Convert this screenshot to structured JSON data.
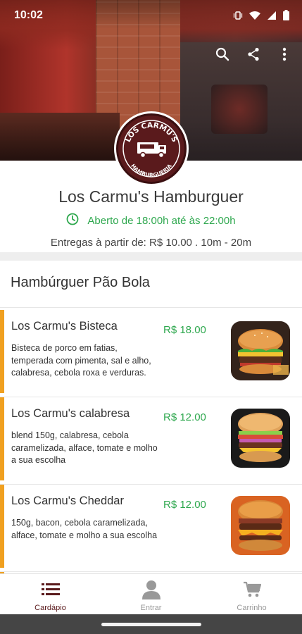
{
  "status_bar": {
    "time": "10:02"
  },
  "store": {
    "name": "Los Carmu's Hamburguer",
    "hours": "Aberto de 18:00h até às 22:00h",
    "delivery": "Entregas à partir de: R$ 10.00 . 10m - 20m",
    "logo_text_top": "LOS CARMU'S",
    "logo_text_bottom": "HAMBURGUERIA"
  },
  "section": {
    "title": "Hambúrguer Pão Bola"
  },
  "products": [
    {
      "name": "Los Carmu's Bisteca",
      "price": "R$ 18.00",
      "description": "Bisteca de porco em fatias, temperada com pimenta, sal e alho, calabresa, cebola roxa e verduras."
    },
    {
      "name": "Los Carmu's calabresa",
      "price": "R$ 12.00",
      "description": "blend 150g, calabresa, cebola caramelizada, alface, tomate e molho a sua escolha"
    },
    {
      "name": "Los Carmu's Cheddar",
      "price": "R$ 12.00",
      "description": "150g, bacon, cebola caramelizada, alface, tomate e molho a sua escolha"
    }
  ],
  "bottom_nav": [
    {
      "label": "Cardápio",
      "icon": "menu-list-icon",
      "active": true
    },
    {
      "label": "Entrar",
      "icon": "person-icon",
      "active": false
    },
    {
      "label": "Carrinho",
      "icon": "cart-icon",
      "active": false
    }
  ],
  "colors": {
    "accent": "#f0a020",
    "price": "#2fa84f",
    "brand": "#5a1a1c"
  }
}
